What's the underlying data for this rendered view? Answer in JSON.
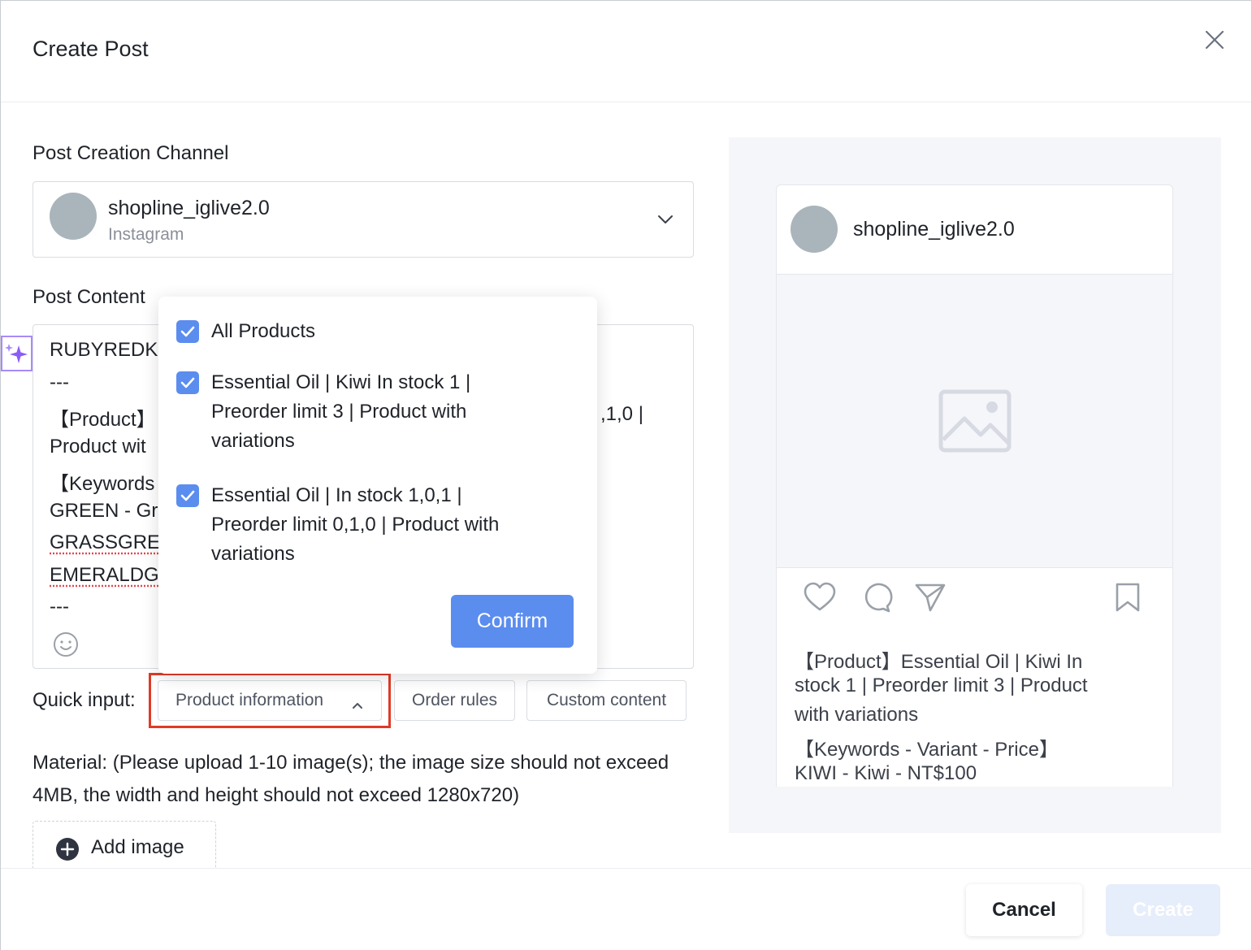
{
  "modal": {
    "title": "Create Post"
  },
  "channel": {
    "label": "Post Creation Channel",
    "name": "shopline_iglive2.0",
    "platform": "Instagram"
  },
  "content": {
    "label": "Post Content",
    "lines": [
      "RUBYREDK",
      "---",
      "【Product】",
      "Product wit",
      "【Keywords",
      "GREEN - Gr",
      "GRASSGRE",
      "EMERALDG",
      "---"
    ],
    "right_fragment": ",1,0 |"
  },
  "dropdown": {
    "options": [
      {
        "lines": [
          "All Products"
        ],
        "checked": true
      },
      {
        "lines": [
          "Essential Oil | Kiwi In stock 1 |",
          "Preorder limit 3 | Product with",
          "variations"
        ],
        "checked": true
      },
      {
        "lines": [
          "Essential Oil | In stock 1,0,1 |",
          "Preorder limit 0,1,0 | Product with",
          "variations"
        ],
        "checked": true
      }
    ],
    "confirm_label": "Confirm"
  },
  "quick_input": {
    "label": "Quick input:",
    "product_info": "Product information",
    "order_rules": "Order rules",
    "custom_content": "Custom content"
  },
  "material": {
    "text": "Material: (Please upload 1-10 image(s); the image size should not exceed 4MB, the width and height should not exceed 1280x720)",
    "add_image": "Add image"
  },
  "preview": {
    "account": "shopline_iglive2.0",
    "caption": [
      "【Product】Essential Oil | Kiwi In",
      "stock 1 | Preorder limit 3 | Product",
      "with variations",
      "【Keywords - Variant - Price】",
      "KIWI - Kiwi - NT$100"
    ]
  },
  "footer": {
    "cancel": "Cancel",
    "create": "Create"
  },
  "colors": {
    "primary": "#5b8def",
    "highlight": "#e03b26",
    "ai_accent": "#a78bfa"
  }
}
